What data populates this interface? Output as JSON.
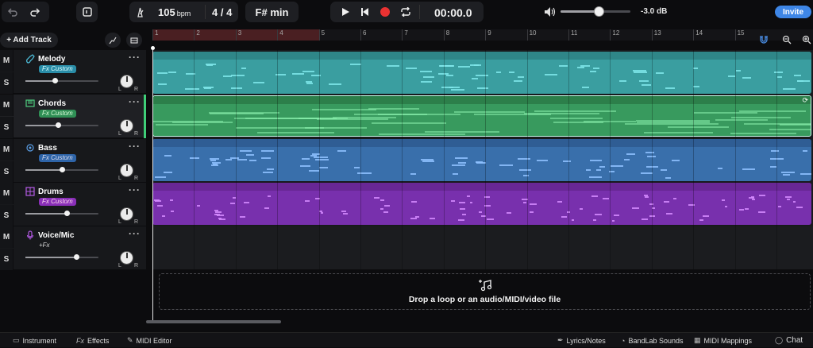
{
  "toolbar": {
    "tempo_value": "105",
    "tempo_unit": "bpm",
    "time_signature": "4 / 4",
    "key": "F# min",
    "time_display": "00:00.0",
    "master_volume": "-3.0 dB",
    "master_volume_level": 0.55,
    "invite_label": "Invite",
    "icons": [
      "undo-icon",
      "redo-icon",
      "metronome-icon",
      "play-icon",
      "skip-back-icon",
      "record-icon",
      "loop-icon",
      "speaker-icon",
      "snap-magnet-icon",
      "zoom-out-icon",
      "zoom-in-icon"
    ]
  },
  "tracks_header": {
    "add_track_label": "+ Add Track"
  },
  "tracks": [
    {
      "name": "Melody",
      "fx": "Fx Custom",
      "fx_color": "#3aaecb",
      "icon": "guitar-icon",
      "volume": 0.4,
      "mute": "M",
      "solo": "S",
      "lane_color": "#3ea6a8",
      "head_color": "#2c8a8c"
    },
    {
      "name": "Chords",
      "fx": "Fx Custom",
      "fx_color": "#3fae6e",
      "icon": "keyboard-icon",
      "volume": 0.45,
      "mute": "M",
      "solo": "S",
      "lane_color": "#3a9a60",
      "head_color": "#2b7c4a"
    },
    {
      "name": "Bass",
      "fx": "Fx Custom",
      "fx_color": "#3a7cc7",
      "icon": "gear-instrument-icon",
      "volume": 0.5,
      "mute": "M",
      "solo": "S",
      "lane_color": "#3a6fac",
      "head_color": "#2e5c94"
    },
    {
      "name": "Drums",
      "fx": "Fx Custom",
      "fx_color": "#9a38c8",
      "icon": "drum-pad-icon",
      "volume": 0.57,
      "mute": "M",
      "solo": "S",
      "lane_color": "#7b2fb0",
      "head_color": "#6a2896"
    },
    {
      "name": "Voice/Mic",
      "fx": "+Fx",
      "fx_color": "",
      "icon": "microphone-icon",
      "volume": 0.7,
      "mute": "M",
      "solo": "S",
      "lane_color": "",
      "head_color": ""
    }
  ],
  "ruler": {
    "bars": [
      "1",
      "2",
      "3",
      "4",
      "5",
      "6",
      "7",
      "8",
      "9",
      "10",
      "11",
      "12",
      "13",
      "14",
      "15"
    ],
    "loop_region": "1-5"
  },
  "dropzone": {
    "label": "Drop a loop or an audio/MIDI/video file"
  },
  "bottom": {
    "instrument": "Instrument",
    "effects": "Effects",
    "midi_editor": "MIDI Editor",
    "lyrics": "Lyrics/Notes",
    "bandlab_sounds": "BandLab Sounds",
    "midi_mappings": "MIDI Mappings",
    "chat": "Chat"
  }
}
